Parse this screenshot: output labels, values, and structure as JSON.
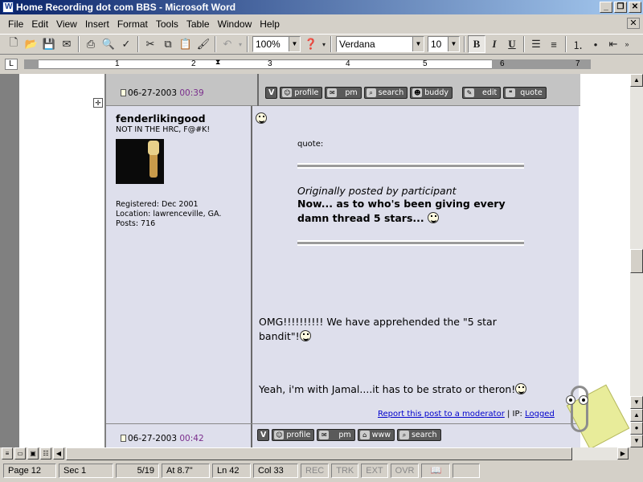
{
  "window": {
    "title": "Home Recording dot com BBS - Microsoft Word",
    "buttons": {
      "minimize": "_",
      "restore": "❐",
      "close": "✕"
    }
  },
  "menu": {
    "items": [
      "File",
      "Edit",
      "View",
      "Insert",
      "Format",
      "Tools",
      "Table",
      "Window",
      "Help"
    ],
    "close_doc": "✕"
  },
  "toolbar": {
    "zoom": "100%",
    "font": "Verdana",
    "font_size": "10",
    "bold": "B",
    "italic": "I",
    "underline": "U"
  },
  "ruler": {
    "numbers": [
      "1",
      "2",
      "3",
      "4",
      "5",
      "6",
      "7"
    ],
    "tab_selector": "L"
  },
  "post_top": {
    "date": "06-27-2003",
    "time": "00:39",
    "buttons": {
      "profile": "profile",
      "pm": "pm",
      "search": "search",
      "buddy": "buddy",
      "edit": "edit",
      "quote": "quote",
      "v": "V"
    }
  },
  "post": {
    "username": "fenderlikingood",
    "user_title": "NOT IN THE HRC, F@#K!",
    "registered": "Registered: Dec 2001",
    "location": "Location: lawrenceville, GA.",
    "posts": "Posts: 716",
    "quote_label": "quote:",
    "quote_by": "Originally posted by participant",
    "quote_text": "Now... as to who's been giving every damn thread 5 stars...",
    "body1": "OMG!!!!!!!!!! We have apprehended the \"5 star bandit\"!",
    "body2": "Yeah, i'm with Jamal....it has to be strato or theron!",
    "report_link": "Report this post to a moderator",
    "ip_label": "| IP:",
    "ip_link": "Logged"
  },
  "post_bottom": {
    "date": "06-27-2003",
    "time": "00:42",
    "buttons": {
      "v": "V",
      "profile": "profile",
      "pm": "pm",
      "www": "www",
      "search": "search"
    }
  },
  "status": {
    "page": "Page  12",
    "section": "Sec  1",
    "pages": "5/19",
    "at": "At  8.7\"",
    "line": "Ln  42",
    "col": "Col  33",
    "rec": "REC",
    "trk": "TRK",
    "ext": "EXT",
    "ovr": "OVR"
  }
}
